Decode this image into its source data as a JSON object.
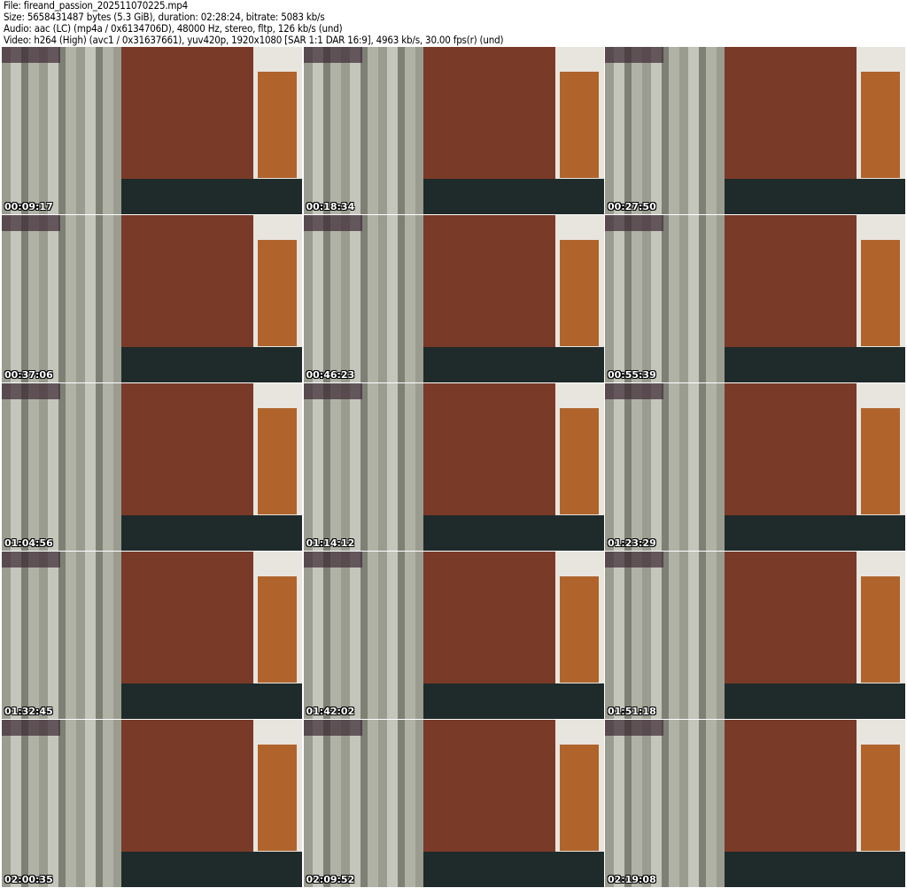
{
  "header": {
    "file": "File: fireand_passion_202511070225.mp4",
    "size": "Size: 5658431487 bytes (5.3 GiB), duration: 02:28:24, bitrate: 5083 kb/s",
    "audio": "Audio: aac (LC) (mp4a / 0x6134706D), 48000 Hz, stereo, fltp, 126 kb/s (und)",
    "video": "Video: h264 (High) (avc1 / 0x31637661), yuv420p, 1920x1080 [SAR 1:1 DAR 16:9], 4963 kb/s, 30.00 fps(r) (und)"
  },
  "thumbnails": [
    {
      "timestamp": "00:09:17"
    },
    {
      "timestamp": "00:18:34"
    },
    {
      "timestamp": "00:27:50"
    },
    {
      "timestamp": "00:37:06"
    },
    {
      "timestamp": "00:46:23"
    },
    {
      "timestamp": "00:55:39"
    },
    {
      "timestamp": "01:04:56"
    },
    {
      "timestamp": "01:14:12"
    },
    {
      "timestamp": "01:23:29"
    },
    {
      "timestamp": "01:32:45"
    },
    {
      "timestamp": "01:42:02"
    },
    {
      "timestamp": "01:51:18"
    },
    {
      "timestamp": "02:00:35"
    },
    {
      "timestamp": "02:09:52"
    },
    {
      "timestamp": "02:19:08"
    }
  ]
}
